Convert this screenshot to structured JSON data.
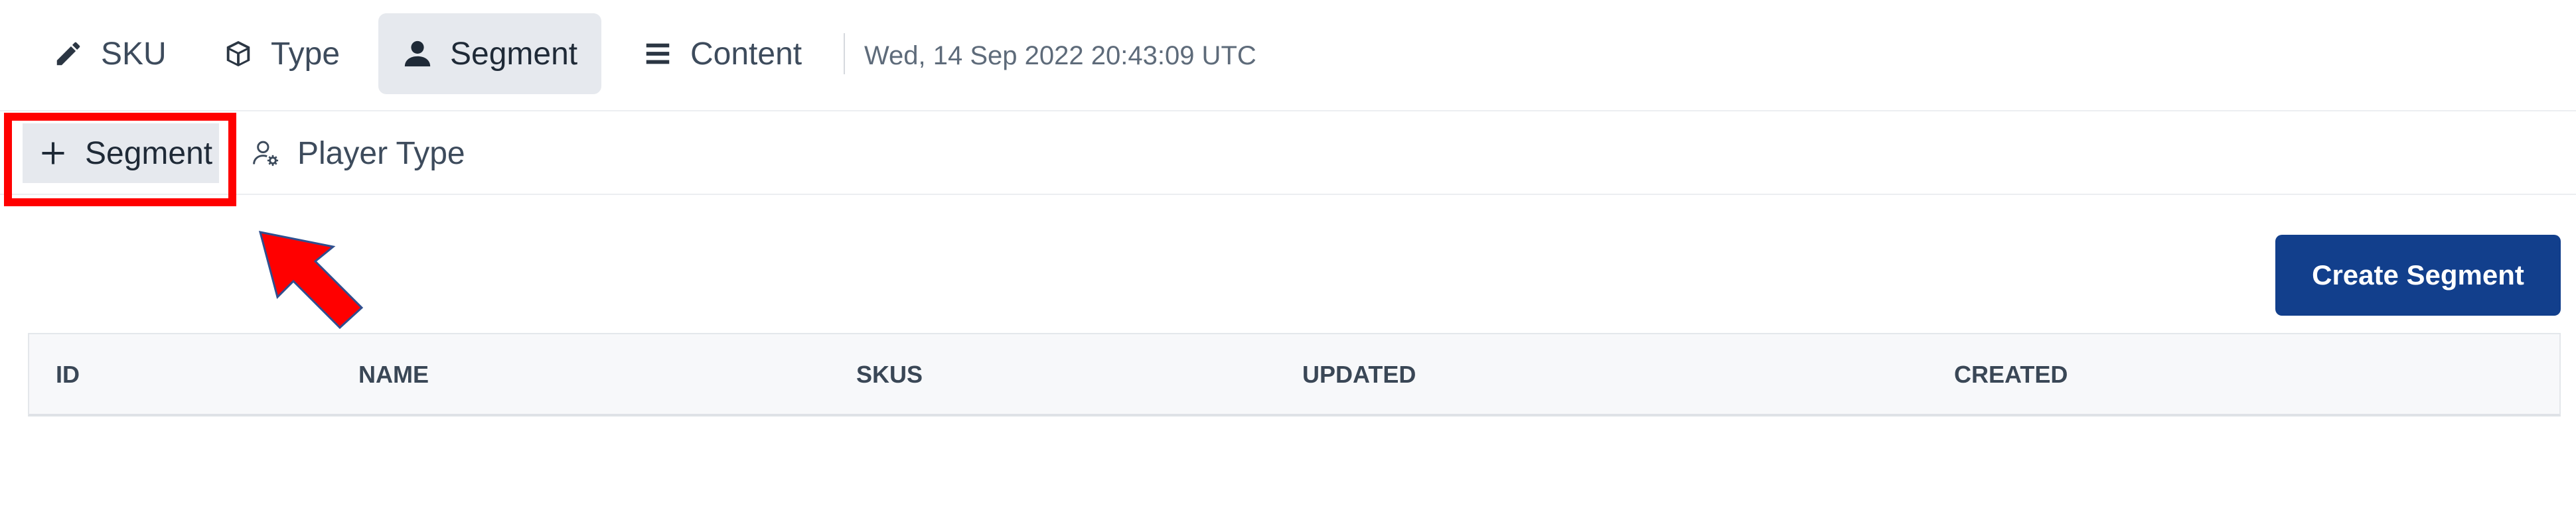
{
  "topnav": {
    "tabs": [
      {
        "id": "sku",
        "label": "SKU",
        "icon": "pencil-icon"
      },
      {
        "id": "type",
        "label": "Type",
        "icon": "cube-icon"
      },
      {
        "id": "segment",
        "label": "Segment",
        "icon": "user-icon",
        "active": true
      },
      {
        "id": "content",
        "label": "Content",
        "icon": "list-icon"
      }
    ],
    "timestamp": "Wed, 14 Sep 2022 20:43:09 UTC"
  },
  "subnav": {
    "tabs": [
      {
        "id": "segment",
        "label": "Segment",
        "icon": "plus-icon",
        "active": true
      },
      {
        "id": "player_type",
        "label": "Player Type",
        "icon": "user-gear-icon"
      }
    ]
  },
  "actions": {
    "create_label": "Create Segment"
  },
  "table": {
    "columns": [
      "ID",
      "NAME",
      "SKUS",
      "UPDATED",
      "CREATED"
    ],
    "rows": []
  },
  "colors": {
    "primary": "#123f8c",
    "active_tab_bg": "#e6e9ee",
    "annotation": "#ff0000"
  }
}
